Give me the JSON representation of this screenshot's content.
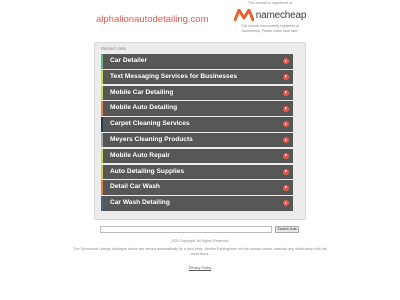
{
  "header": {
    "domain": "alphalionautodetailing.com",
    "registrar_top": "This domain is registered at",
    "registrar_name": "namecheap",
    "registrar_note_1": "This domain was recently registered at",
    "registrar_note_2": "Namecheap. Please check back later!"
  },
  "panel": {
    "heading": "Related Links",
    "links": [
      {
        "label": "Car Detailer",
        "accent": "#5fb878"
      },
      {
        "label": "Text Messaging Services for Businesses",
        "accent": "#c9d84a"
      },
      {
        "label": "Mobile Car Detailing",
        "accent": "#c9d84a"
      },
      {
        "label": "Mobile Auto Detailing",
        "accent": "#e8823a"
      },
      {
        "label": "Carpet Cleaning Services",
        "accent": "#1f3d4a"
      },
      {
        "label": "Meyers Cleaning Products",
        "accent": "#a6a6a6"
      },
      {
        "label": "Mobile Auto Repair",
        "accent": "#c9d84a"
      },
      {
        "label": "Auto Detailing Supplies",
        "accent": "#d9c64a"
      },
      {
        "label": "Detail Car Wash",
        "accent": "#e8823a"
      },
      {
        "label": "Car Wash Detailing",
        "accent": "#3d6a88"
      }
    ]
  },
  "search": {
    "value": "",
    "button_label": "Search Ads"
  },
  "footer": {
    "copyright": "2020 Copyright. All Rights Reserved.",
    "disclaimer": "The Sponsored Listings displayed above are served automatically by a third party. Neither Parkingcrew nor the domain owner maintain any relationship with the advertisers.",
    "privacy": "Privacy Policy"
  },
  "colors": {
    "accent": "#e85a4f",
    "link_bg": "#575757",
    "panel_bg": "#ececec"
  }
}
